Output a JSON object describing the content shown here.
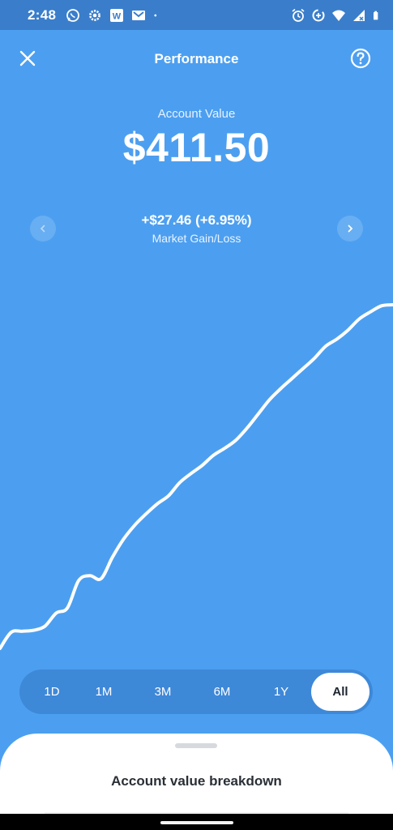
{
  "status_bar": {
    "time": "2:48",
    "left_icons": [
      "whatsapp-icon",
      "settings-icon",
      "word-icon",
      "mail-icon",
      "dot-icon"
    ],
    "right_icons": [
      "alarm-icon",
      "data-saver-icon",
      "wifi-icon",
      "signal-icon",
      "battery-icon"
    ]
  },
  "header": {
    "title": "Performance",
    "close_icon": "close-icon",
    "help_icon": "help-icon"
  },
  "summary": {
    "account_label": "Account Value",
    "account_value": "$411.50",
    "gain_value": "+$27.46 (+6.95%)",
    "gain_label": "Market Gain/Loss"
  },
  "chart_data": {
    "type": "line",
    "title": "",
    "xlabel": "",
    "ylabel": "",
    "grid": false,
    "legend": "none",
    "line_color": "#ffffff",
    "series": [
      {
        "values": [
          0,
          16,
          17,
          18,
          22,
          35,
          40,
          67,
          72,
          69,
          90,
          108,
          122,
          133,
          143,
          151,
          164,
          173,
          181,
          191,
          198,
          206,
          218,
          232,
          246,
          257,
          267,
          277,
          287,
          299,
          306,
          315,
          326,
          333,
          339,
          340
        ]
      }
    ]
  },
  "range_selector": {
    "options": [
      "1D",
      "1M",
      "3M",
      "6M",
      "1Y",
      "All"
    ],
    "selected": "All"
  },
  "sheet": {
    "title": "Account value breakdown"
  },
  "colors": {
    "background": "#4c9ff0",
    "status_bar": "#3a7ecb",
    "range_bar": "#3e88d8"
  }
}
